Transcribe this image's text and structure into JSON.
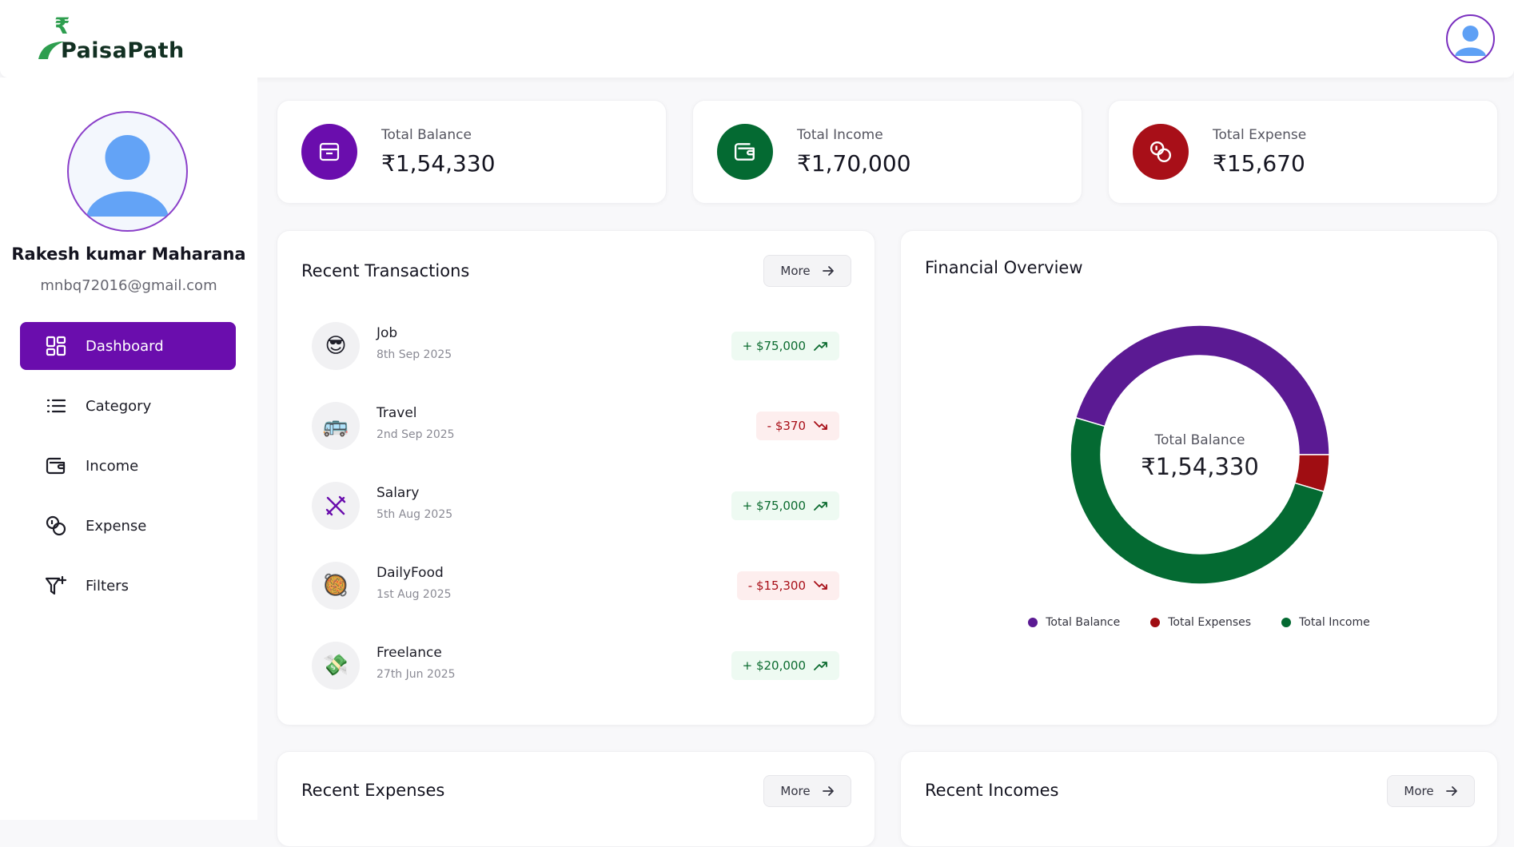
{
  "app": {
    "name": "PaisaPath"
  },
  "user": {
    "name": "Rakesh kumar Maharana",
    "email": "mnbq72016@gmail.com"
  },
  "sidebar": {
    "items": [
      {
        "label": "Dashboard",
        "icon": "dashboard-icon",
        "active": true
      },
      {
        "label": "Category",
        "icon": "list-icon"
      },
      {
        "label": "Income",
        "icon": "wallet-icon"
      },
      {
        "label": "Expense",
        "icon": "coins-icon"
      },
      {
        "label": "Filters",
        "icon": "filter-plus-icon"
      }
    ]
  },
  "stats": [
    {
      "label": "Total Balance",
      "value": "₹1,54,330",
      "color": "#6a0dad",
      "icon": "card-icon"
    },
    {
      "label": "Total Income",
      "value": "₹1,70,000",
      "color": "#046a32",
      "icon": "wallet-icon"
    },
    {
      "label": "Total Expense",
      "value": "₹15,670",
      "color": "#a80f18",
      "icon": "coins-icon"
    }
  ],
  "recent_transactions": {
    "title": "Recent Transactions",
    "more_label": "More",
    "items": [
      {
        "icon": "😎",
        "name": "Job",
        "date": "8th Sep 2025",
        "amount": "+ $75,000",
        "type": "income"
      },
      {
        "icon": "🚌",
        "name": "Travel",
        "date": "2nd Sep 2025",
        "amount": "- $370",
        "type": "expense"
      },
      {
        "icon": "utensils-icon",
        "name": "Salary",
        "date": "5th Aug 2025",
        "amount": "+ $75,000",
        "type": "income"
      },
      {
        "icon": "🥘",
        "name": "DailyFood",
        "date": "1st Aug 2025",
        "amount": "- $15,300",
        "type": "expense"
      },
      {
        "icon": "💸",
        "name": "Freelance",
        "date": "27th Jun 2025",
        "amount": "+ $20,000",
        "type": "income"
      }
    ]
  },
  "financial_overview": {
    "title": "Financial Overview",
    "center_label": "Total Balance",
    "center_value": "₹1,54,330"
  },
  "chart_data": {
    "type": "pie",
    "donut": true,
    "labels": [
      "Total Balance",
      "Total Expenses",
      "Total Income"
    ],
    "values": [
      154330,
      15670,
      170000
    ],
    "colors": [
      "#5b1a93",
      "#a00d12",
      "#046a32"
    ],
    "legend": "bottom"
  },
  "recent_expenses": {
    "title": "Recent Expenses",
    "more_label": "More"
  },
  "recent_incomes": {
    "title": "Recent Incomes",
    "more_label": "More"
  }
}
